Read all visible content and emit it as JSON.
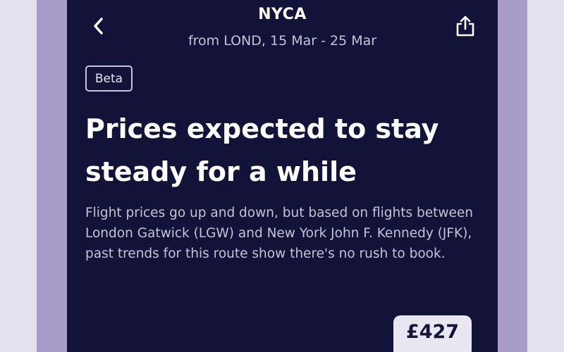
{
  "header": {
    "title": "NYCA",
    "subtitle": "from LOND, 15 Mar - 25 Mar",
    "back_icon": "chevron-left-icon",
    "share_icon": "share-icon"
  },
  "badge": "Beta",
  "headline": "Prices expected to stay steady for a while",
  "description": "Flight prices go up and down, but based on flights between London Gatwick (LGW) and New York John F. Kennedy (JFK), past trends for this route show there's no rush to book.",
  "price": "£427",
  "colors": {
    "background": "#131339",
    "side_band": "#a89ccb",
    "outer": "#e6e1ee",
    "text_primary": "#ffffff",
    "text_secondary": "#c5c3d6"
  }
}
